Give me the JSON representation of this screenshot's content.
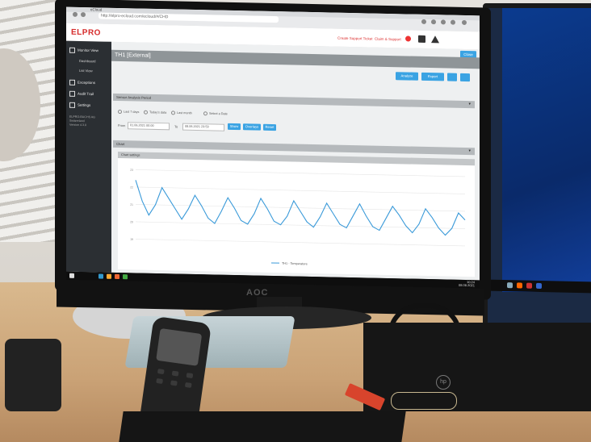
{
  "browser": {
    "url": "http://elpro-ecloud.com/ecloud/#/CHD",
    "tab_title": "eCloud"
  },
  "header": {
    "logo_text": "ELPRO",
    "link_support": "Create Support Ticket",
    "link_user": "Claim & Support"
  },
  "sidebar": {
    "items": [
      {
        "label": "Monitor View"
      },
      {
        "label": "Dashboard"
      },
      {
        "label": "List View"
      },
      {
        "label": "Exceptions"
      },
      {
        "label": "Audit Trail"
      },
      {
        "label": "Settings"
      }
    ],
    "info_lines": [
      "ELPRO-BUCHS AG",
      "Switzerland",
      "Version 4.3.0"
    ]
  },
  "main": {
    "close_label": "Close",
    "page_title": "TH1 [External]",
    "buttons": {
      "analyze": "Analyze",
      "export": "Export"
    },
    "section_time_range": "Sensor Analysis Period",
    "radio_options": [
      "Last 7 days",
      "Today's data",
      "Last month",
      "Select a Date"
    ],
    "from_label": "From",
    "from_value": "01.06.2021 00:00",
    "to_label": "To",
    "to_value": "08.06.2021 23:59",
    "apply_buttons": [
      "Show",
      "Overlays",
      "Reset"
    ],
    "section_chart": "Chart",
    "chart_sub": "Chart settings"
  },
  "chart_data": {
    "type": "line",
    "title": "",
    "series": [
      {
        "name": "TH1 - Temperature",
        "values": [
          22.4,
          21.2,
          20.4,
          21.0,
          22.0,
          21.4,
          20.8,
          20.2,
          20.8,
          21.6,
          21.0,
          20.3,
          20.0,
          20.7,
          21.5,
          20.9,
          20.2,
          20.0,
          20.6,
          21.5,
          20.9,
          20.2,
          20.0,
          20.5,
          21.4,
          20.8,
          20.2,
          19.9,
          20.5,
          21.3,
          20.7,
          20.1,
          19.9,
          20.6,
          21.3,
          20.6,
          20.0,
          19.8,
          20.5,
          21.2,
          20.7,
          20.1,
          19.7,
          20.2,
          21.1,
          20.6,
          20.0,
          19.6,
          20.0,
          20.9,
          20.5
        ]
      }
    ],
    "legend": "bottom",
    "grid": true,
    "ylim": [
      19,
      23
    ]
  },
  "taskbar": {
    "time": "10:24",
    "date": "08.06.2021"
  },
  "scene": {
    "monitor_brand": "AOC",
    "pc_brand": "hp"
  }
}
